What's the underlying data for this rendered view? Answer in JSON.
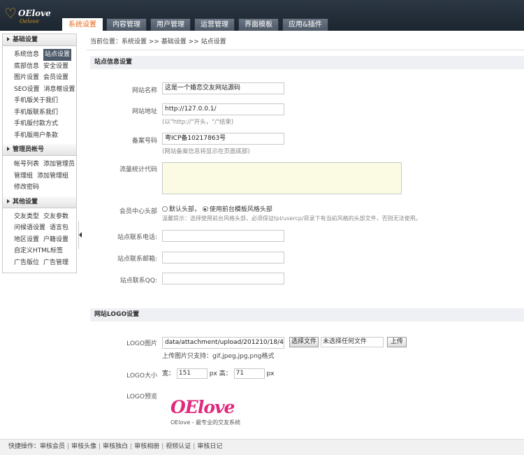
{
  "app": {
    "logo_text": "OElove",
    "logo_script": "Oelove"
  },
  "nav": {
    "tabs": [
      "系统设置",
      "内容管理",
      "用户管理",
      "运营管理",
      "界面模板",
      "应用&插件"
    ]
  },
  "sidebar": {
    "groups": [
      {
        "title": "基础设置",
        "rows": [
          [
            "系统信息",
            "站点设置"
          ],
          [
            "底部信息",
            "安全设置"
          ],
          [
            "图片设置",
            "会员设置"
          ],
          [
            "SEO设置",
            "消息框设置"
          ],
          [
            "手机版关于我们"
          ],
          [
            "手机版联系我们"
          ],
          [
            "手机版付款方式"
          ],
          [
            "手机版用户条款"
          ]
        ]
      },
      {
        "title": "管理员帐号",
        "rows": [
          [
            "帐号列表",
            "添加管理员"
          ],
          [
            "管理组",
            "添加管理组"
          ],
          [
            "修改密码"
          ]
        ]
      },
      {
        "title": "其他设置",
        "rows": [
          [
            "交友类型",
            "交友参数"
          ],
          [
            "问候语设置",
            "语言包"
          ],
          [
            "地区设置",
            "户籍设置"
          ],
          [
            "自定义HTML标签"
          ],
          [
            "广告版位",
            "广告管理"
          ]
        ]
      }
    ],
    "selected": "站点设置"
  },
  "breadcrumb": "当前位置：系统设置 >> 基础设置 >> 站点设置",
  "site_section": {
    "title": "站点信息设置",
    "site_name_label": "网站名称",
    "site_name_value": "这是一个婚恋交友网站源码",
    "site_url_label": "网站地址",
    "site_url_value": "http://127.0.0.1/",
    "site_url_hint": "(以\"http://\"开头，\"/\"结束)",
    "icp_label": "备案号码",
    "icp_value": "粤ICP备10217863号",
    "icp_hint": "(网站备案信息将显示在页面底部)",
    "stats_label": "流量统计代码",
    "stats_value": "",
    "header_label": "会员中心头部",
    "header_opt_default": "默认头部，",
    "header_opt_theme": "使用前台模板风格头部",
    "header_hint": "温馨提示：选择使用前台风格头部，必须保证tpl/usercp/目录下有当前风格的头部文件，否则无法使用。",
    "phone_label": "站点联系电话:",
    "email_label": "站点联系邮箱:",
    "qq_label": "站点联系QQ:"
  },
  "logo_section": {
    "title": "网站LOGO设置",
    "logo_img_label": "LOGO图片",
    "logo_path": "data/attachment/upload/201210/18/48b75332",
    "choose_btn": "选择文件",
    "no_file": "未选择任何文件",
    "upload_btn": "上传",
    "format_hint": "上传图片只支持：gif,jpeg,jpg,png格式",
    "size_label": "LOGO大小",
    "width_label": "宽：",
    "width_value": "151",
    "height_label": "高：",
    "height_value": "71",
    "unit": "px",
    "preview_label": "LOGO预览",
    "preview_logo": "OElove",
    "preview_tagline": "OElove - 最专业的交友系统"
  },
  "footer": {
    "label": "快捷操作：",
    "links": [
      "审核会员",
      "审核头像",
      "审核独白",
      "审核相册",
      "视频认证",
      "审核日记"
    ]
  }
}
